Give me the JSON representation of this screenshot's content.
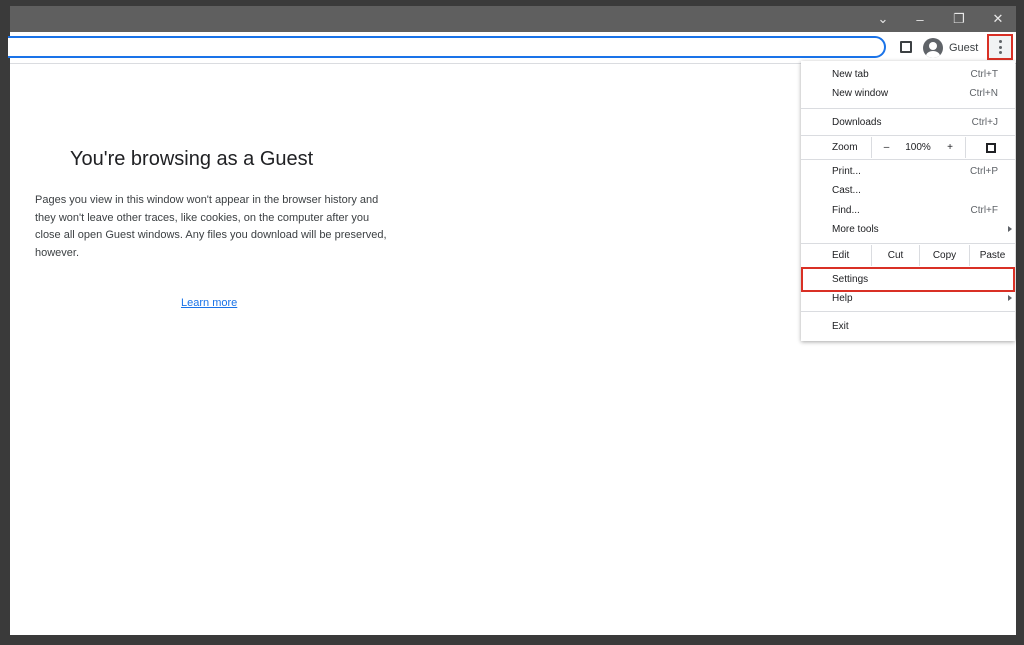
{
  "window": {
    "minimize_glyph": "–",
    "restore_glyph": "❐",
    "close_glyph": "✕",
    "tabs_dropdown_glyph": "⌄"
  },
  "toolbar": {
    "profile_label": "Guest"
  },
  "page": {
    "title": "You're browsing as a Guest",
    "description": "Pages you view in this window won't appear in the browser history and they won't leave other traces, like cookies, on the computer after you close all open Guest windows. Any files you download will be preserved, however.",
    "learn_more": "Learn more"
  },
  "menu": {
    "new_tab": {
      "label": "New tab",
      "shortcut": "Ctrl+T"
    },
    "new_window": {
      "label": "New window",
      "shortcut": "Ctrl+N"
    },
    "downloads": {
      "label": "Downloads",
      "shortcut": "Ctrl+J"
    },
    "zoom": {
      "label": "Zoom",
      "minus": "–",
      "value": "100%",
      "plus": "+"
    },
    "print": {
      "label": "Print...",
      "shortcut": "Ctrl+P"
    },
    "cast": {
      "label": "Cast..."
    },
    "find": {
      "label": "Find...",
      "shortcut": "Ctrl+F"
    },
    "more_tools": {
      "label": "More tools"
    },
    "edit": {
      "label": "Edit",
      "cut": "Cut",
      "copy": "Copy",
      "paste": "Paste"
    },
    "settings": {
      "label": "Settings"
    },
    "help": {
      "label": "Help"
    },
    "exit": {
      "label": "Exit"
    }
  },
  "colors": {
    "highlight": "#d93025",
    "accent": "#1a73e8"
  }
}
